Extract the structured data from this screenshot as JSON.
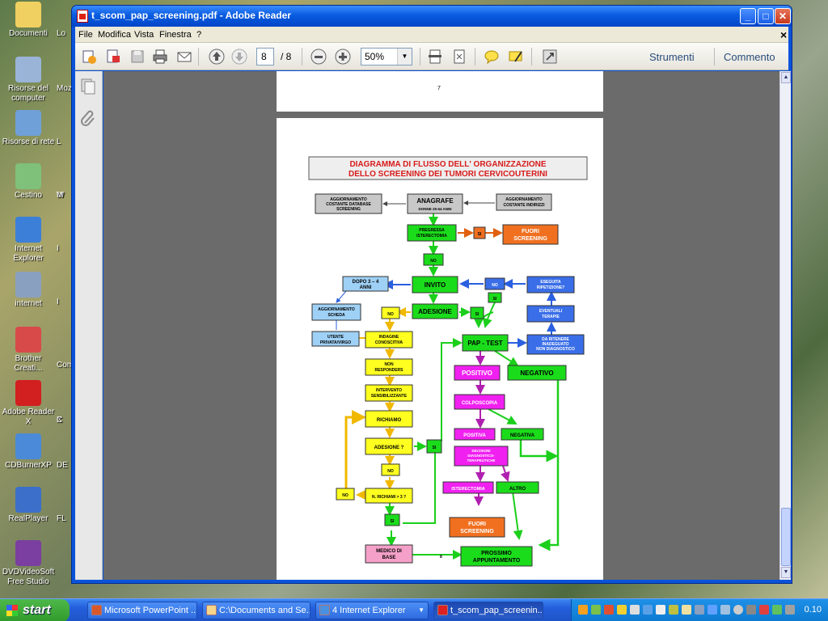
{
  "desktop": {
    "icons": [
      {
        "label": "Documenti",
        "color": "#f0d060"
      },
      {
        "label": "Risorse del computer",
        "color": "#9ab4d8"
      },
      {
        "label": "Risorse di rete",
        "color": "#6fa0d8"
      },
      {
        "label": "Cestino",
        "color": "#7fc07a"
      },
      {
        "label": "Internet Explorer",
        "color": "#3c7fd8"
      },
      {
        "label": "internet",
        "color": "#8aa0c0"
      },
      {
        "label": "Brother Creati...",
        "color": "#d84a4a"
      },
      {
        "label": "Adobe Reader X",
        "color": "#d21f1f"
      },
      {
        "label": "CDBurnerXP",
        "color": "#4a8ad8"
      },
      {
        "label": "RealPlayer",
        "color": "#3b6fc9"
      },
      {
        "label": "DVDVideoSoft Free Studio",
        "color": "#7a3fa0"
      }
    ],
    "edge_labels": [
      "Lo",
      "Moz",
      "L",
      "W",
      "M",
      "I",
      "I",
      "Com",
      "X",
      "C",
      "DE",
      "FL"
    ]
  },
  "window": {
    "title": "t_scom_pap_screening.pdf - Adobe Reader",
    "menu": [
      "File",
      "Modifica",
      "Vista",
      "Finestra",
      "?"
    ],
    "close_doc": "×",
    "page_current": "8",
    "page_total": "/ 8",
    "zoom": "50%",
    "tools_label": "Strumenti",
    "comment_label": "Commento"
  },
  "document": {
    "prev_page_number": "7",
    "page_number": "8",
    "title_line1": "DIAGRAMMA DI FLUSSO DELL' ORGANIZZAZIONE",
    "title_line2": "DELLO SCREENING DEI TUMORI CERVICOUTERINI",
    "boxes": {
      "agg_db": [
        "AGGIORNAMENTO",
        "COSTANTE DATABASE",
        "SCREENING"
      ],
      "anagrafe": [
        "ANAGRAFE",
        "DONNE 25-64 ANNI"
      ],
      "agg_ind": [
        "AGGIORNAMENTO",
        "COSTANTE INDIRIZZI"
      ],
      "isterectomia_q": [
        "PREGRESSA",
        "ISTERECTOMIA"
      ],
      "si1": "SI",
      "fuori1": [
        "FUORI",
        "SCREENING"
      ],
      "no1": "NO",
      "dopo": [
        "DOPO 3 – 4",
        "ANNI"
      ],
      "invito": "INVITO",
      "no_blue": "NO",
      "eseguita": [
        "ESEGUITA",
        "RIPETIZIONE?"
      ],
      "si_small": "SI",
      "agg_scheda": [
        "AGGIORNAMENTO",
        "SCHEDA"
      ],
      "no2": "NO",
      "adesione": "ADESIONE",
      "si2": "SI",
      "eventuali": [
        "EVENTUALI",
        "TERAPIE"
      ],
      "utente": [
        "UTENTE",
        "PRIVATA/VIRGO"
      ],
      "indagine": [
        "INDAGINE",
        "CONOSCITIVA"
      ],
      "paptest": "PAP - TEST",
      "inadeguato": [
        "DA RITENERE",
        "INADEGUATO",
        "NON DIAGNOSTICO"
      ],
      "non_resp": [
        "NON",
        "RESPONDERS"
      ],
      "positivo": "POSITIVO",
      "negativo": "NEGATIVO",
      "intervento": [
        "INTERVENTO",
        "SENSIBILIZZANTE"
      ],
      "colposcopia": "COLPOSCOPIA",
      "richiamo": "RICHIAMO",
      "positiva": "POSITIVA",
      "negativa": "NEGATIVA",
      "adesione_q": "ADESIONE ?",
      "si3": "SI",
      "decisioni": [
        "DECISIONI",
        "DIAGNOSTICO-",
        "TERAPEUTICHE"
      ],
      "no3": "NO",
      "no4": "NO",
      "n_richiami": "N. RICHIAMI > 3 ?",
      "isterectomia": "ISTERECTOMIA",
      "altro": "ALTRO",
      "si4": "SI",
      "fuori2": [
        "FUORI",
        "SCREENING"
      ],
      "medico": [
        "MEDICO DI",
        "BASE"
      ],
      "prossimo": [
        "PROSSIMO",
        "APPUNTAMENTO"
      ]
    }
  },
  "taskbar": {
    "start": "start",
    "tasks": [
      "Microsoft PowerPoint ...",
      "C:\\Documents and Se...",
      "4 Internet Explorer",
      "t_scom_pap_screenin..."
    ],
    "clock": "0.10"
  }
}
